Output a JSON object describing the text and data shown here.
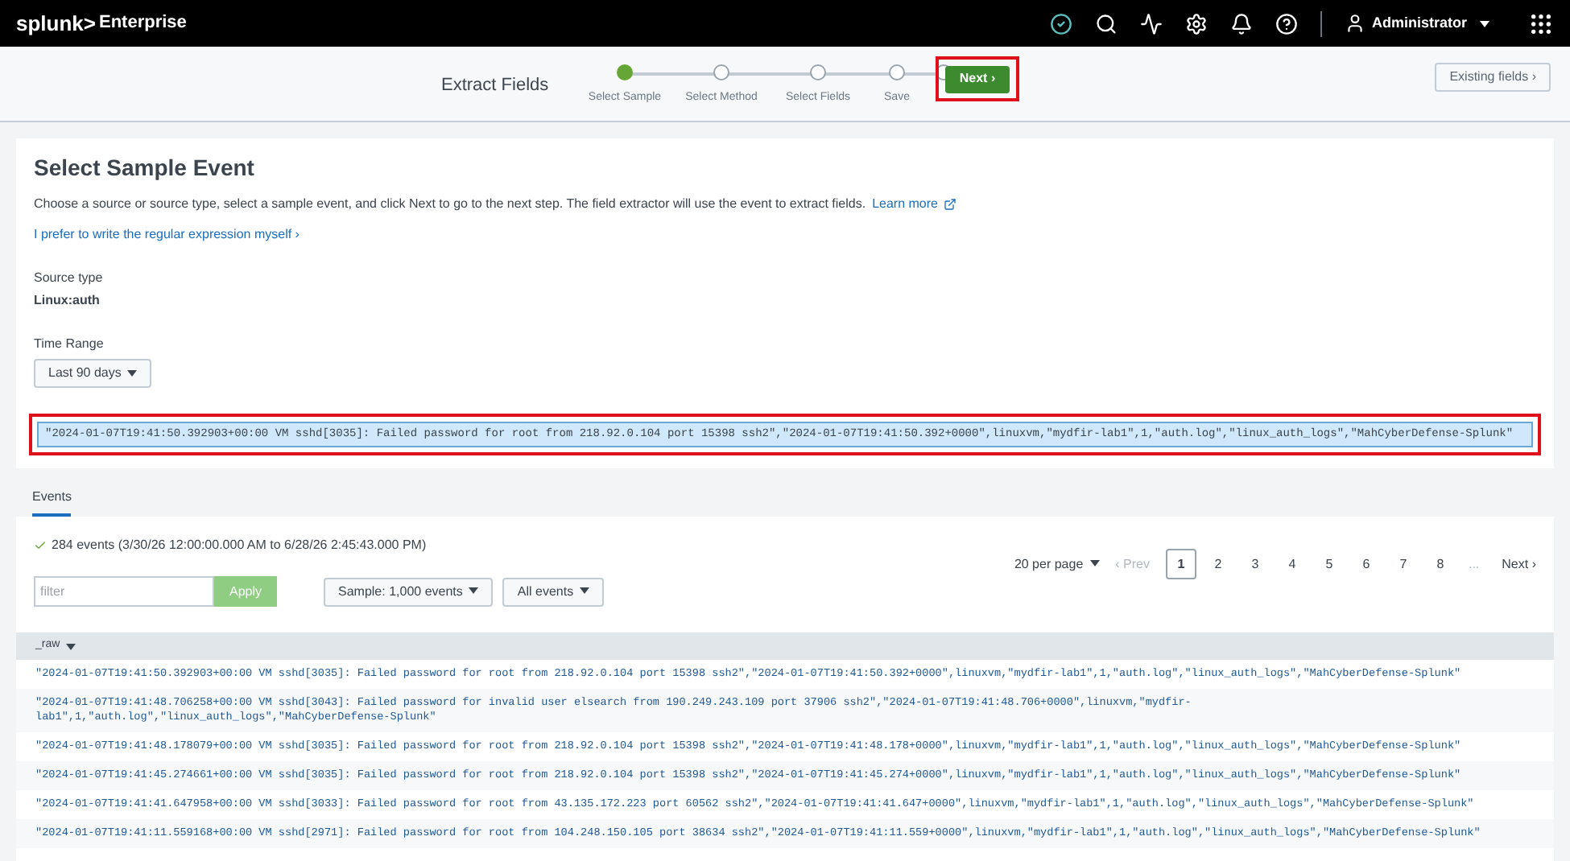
{
  "topbar": {
    "logo": "splunk>",
    "product": "Enterprise",
    "user": "Administrator"
  },
  "wizard": {
    "title": "Extract Fields",
    "steps": [
      {
        "label": "Select Sample",
        "selected": true
      },
      {
        "label": "Select Method",
        "selected": false
      },
      {
        "label": "Select Fields",
        "selected": false
      },
      {
        "label": "Save",
        "selected": false
      },
      {
        "selected": false
      }
    ],
    "next": "Next ›",
    "existing": "Existing fields ›"
  },
  "page": {
    "title": "Select Sample Event",
    "intro": "Choose a source or source type, select a sample event, and click Next to go to the next step. The field extractor will use the event to extract fields.",
    "learn_more": "Learn more",
    "regex_link": "I prefer to write the regular expression myself ›",
    "source_type_label": "Source type",
    "source_type": "Linux:auth",
    "time_range_label": "Time Range",
    "time_range": "Last 90 days"
  },
  "selected_event": "\"2024-01-07T19:41:50.392903+00:00 VM sshd[3035]: Failed password for root from 218.92.0.104 port 15398 ssh2\",\"2024-01-07T19:41:50.392+0000\",linuxvm,\"mydfir-lab1\",1,\"auth.log\",\"linux_auth_logs\",\"MahCyberDefense-Splunk\"",
  "tabs": [
    {
      "label": "Events",
      "selected": true
    }
  ],
  "events": {
    "summary": "284 events (3/30/26 12:00:00.000 AM to 6/28/26 2:45:43.000 PM)",
    "filter_placeholder": "filter",
    "apply": "Apply",
    "sample": "Sample: 1,000 events",
    "all_events": "All events",
    "per_page": "20 per page",
    "prev": "‹ Prev",
    "pages": [
      {
        "label": "1",
        "selected": true
      },
      {
        "label": "2",
        "selected": false
      },
      {
        "label": "3",
        "selected": false
      },
      {
        "label": "4",
        "selected": false
      },
      {
        "label": "5",
        "selected": false
      },
      {
        "label": "6",
        "selected": false
      },
      {
        "label": "7",
        "selected": false
      },
      {
        "label": "8",
        "selected": false
      }
    ],
    "ellipsis": "...",
    "next": "Next ›",
    "column": "_raw",
    "rows": [
      "\"2024-01-07T19:41:50.392903+00:00 VM sshd[3035]: Failed password for root from 218.92.0.104 port 15398 ssh2\",\"2024-01-07T19:41:50.392+0000\",linuxvm,\"mydfir-lab1\",1,\"auth.log\",\"linux_auth_logs\",\"MahCyberDefense-Splunk\"",
      "\"2024-01-07T19:41:48.706258+00:00 VM sshd[3043]: Failed password for invalid user elsearch from 190.249.243.109 port 37906 ssh2\",\"2024-01-07T19:41:48.706+0000\",linuxvm,\"mydfir-lab1\",1,\"auth.log\",\"linux_auth_logs\",\"MahCyberDefense-Splunk\"",
      "\"2024-01-07T19:41:48.178079+00:00 VM sshd[3035]: Failed password for root from 218.92.0.104 port 15398 ssh2\",\"2024-01-07T19:41:48.178+0000\",linuxvm,\"mydfir-lab1\",1,\"auth.log\",\"linux_auth_logs\",\"MahCyberDefense-Splunk\"",
      "\"2024-01-07T19:41:45.274661+00:00 VM sshd[3035]: Failed password for root from 218.92.0.104 port 15398 ssh2\",\"2024-01-07T19:41:45.274+0000\",linuxvm,\"mydfir-lab1\",1,\"auth.log\",\"linux_auth_logs\",\"MahCyberDefense-Splunk\"",
      "\"2024-01-07T19:41:41.647958+00:00 VM sshd[3033]: Failed password for root from 43.135.172.223 port 60562 ssh2\",\"2024-01-07T19:41:41.647+0000\",linuxvm,\"mydfir-lab1\",1,\"auth.log\",\"linux_auth_logs\",\"MahCyberDefense-Splunk\"",
      "\"2024-01-07T19:41:11.559168+00:00 VM sshd[2971]: Failed password for root from 104.248.150.105 port 38634 ssh2\",\"2024-01-07T19:41:11.559+0000\",linuxvm,\"mydfir-lab1\",1,\"auth.log\",\"linux_auth_logs\",\"MahCyberDefense-Splunk\""
    ]
  }
}
